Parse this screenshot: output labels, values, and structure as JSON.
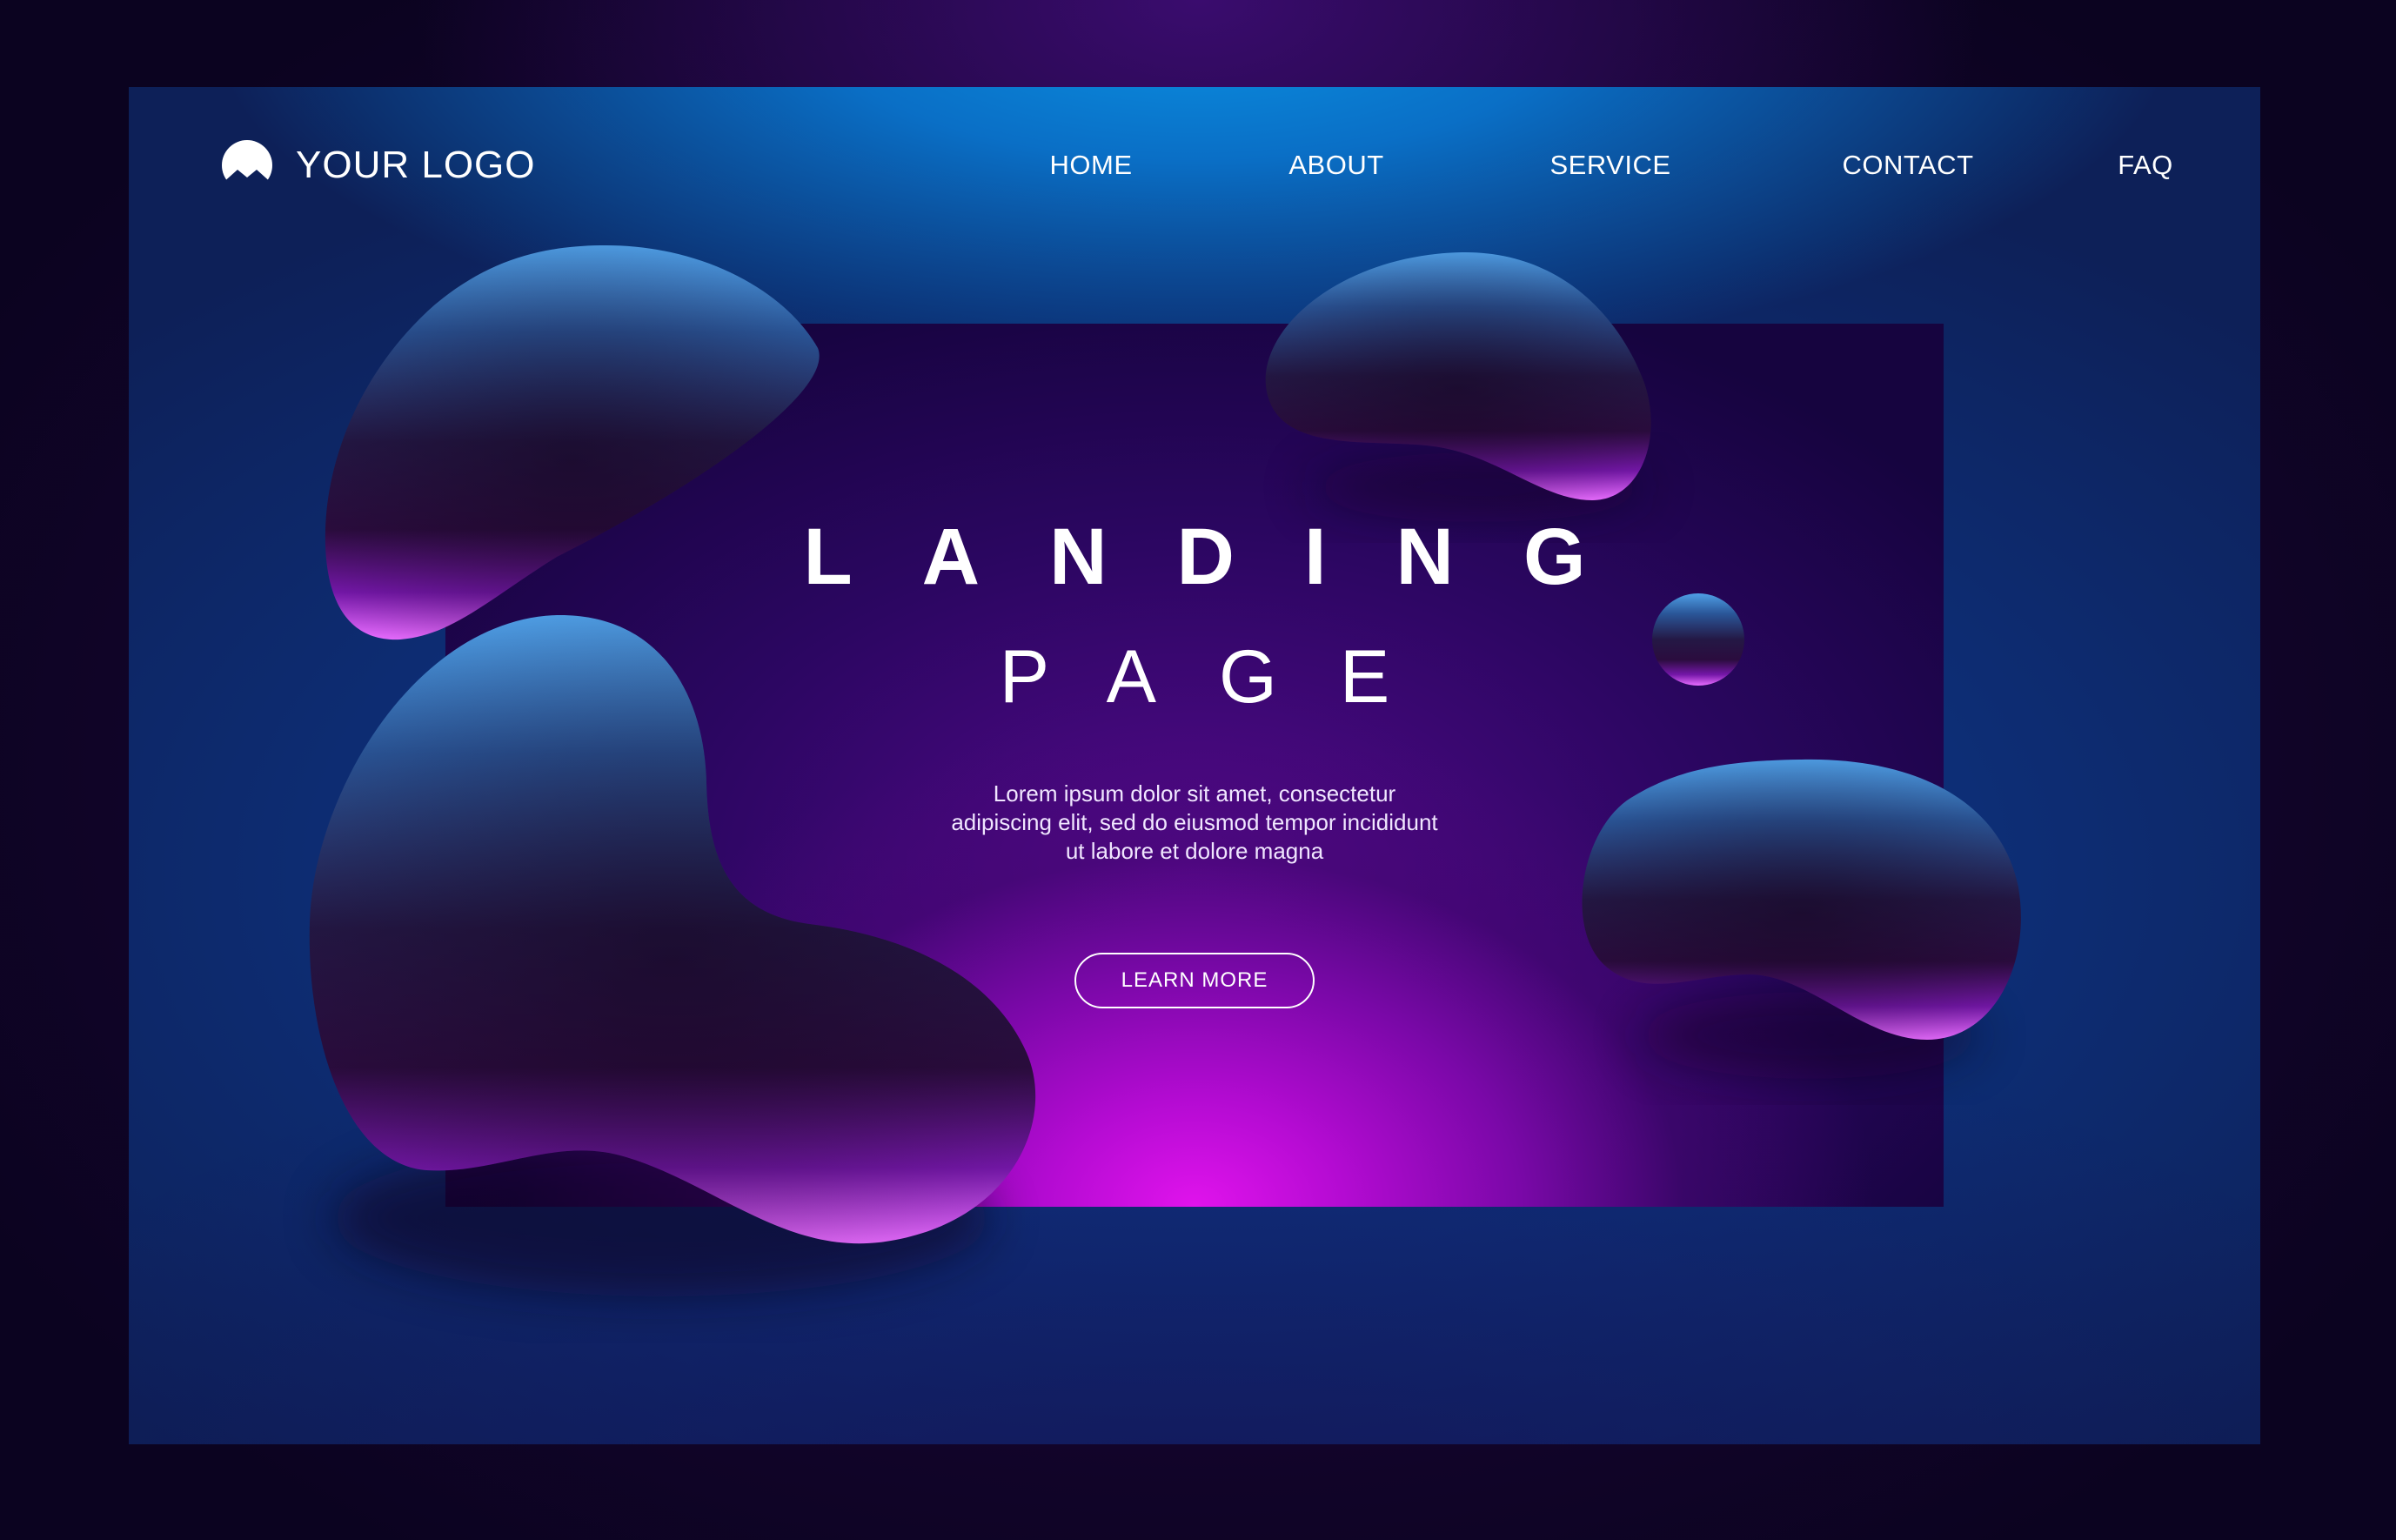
{
  "header": {
    "logo_text": "YOUR LOGO",
    "logo_icon": "mountain-circle-icon",
    "nav": [
      {
        "label": "HOME"
      },
      {
        "label": "ABOUT"
      },
      {
        "label": "SERVICE"
      },
      {
        "label": "CONTACT"
      },
      {
        "label": "FAQ"
      }
    ]
  },
  "hero": {
    "title_line1": "LANDING",
    "title_line2": "PAGE",
    "body_text": "Lorem ipsum dolor sit amet, consectetur adipiscing elit, sed do eiusmod tempor incididunt ut labore et dolore magna",
    "button_label": "LEARN MORE"
  },
  "colors": {
    "background_outer": "#150530",
    "frame_blue": "#0a6fc6",
    "hero_dark": "#16043f",
    "hero_magenta": "#e013ec",
    "text": "#ffffff"
  }
}
